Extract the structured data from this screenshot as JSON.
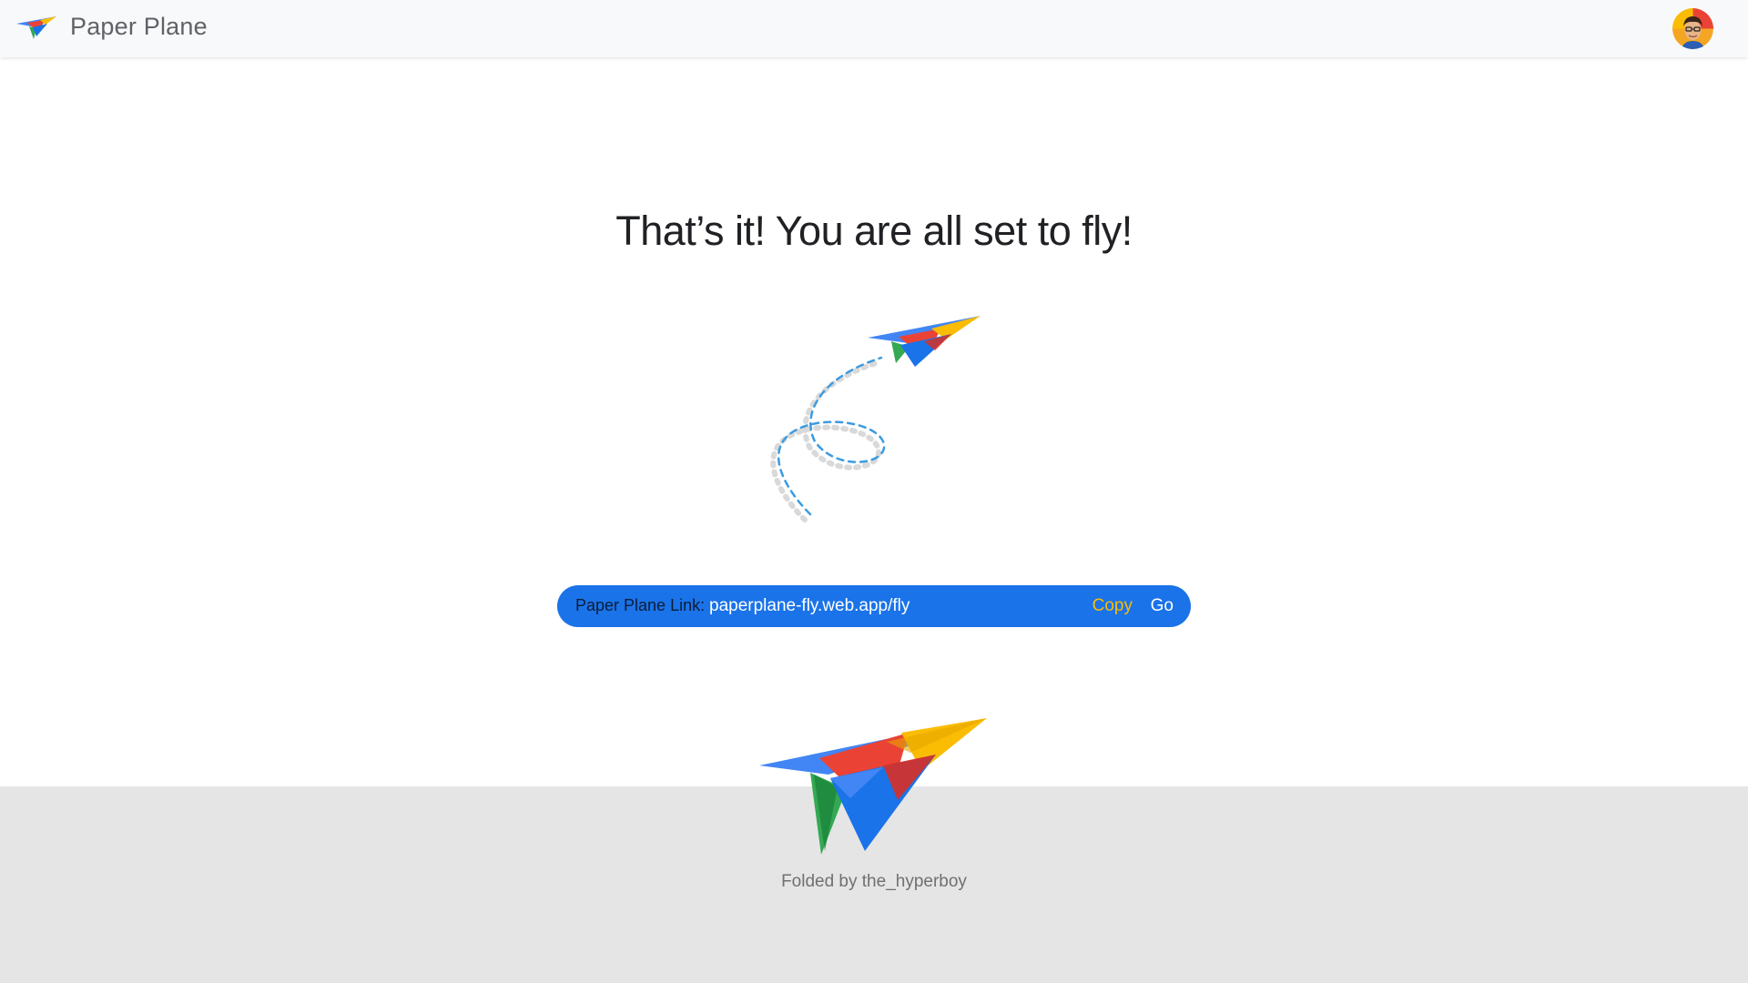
{
  "header": {
    "title": "Paper Plane",
    "logo_icon": "paper-plane-logo-icon",
    "avatar_icon": "user-avatar-icon"
  },
  "main": {
    "headline": "That’s it! You are all set to fly!",
    "illustration_icon": "paper-plane-flight-path-icon"
  },
  "link_bar": {
    "label": "Paper Plane Link:",
    "url": "paperplane-fly.web.app/fly",
    "copy_label": "Copy",
    "go_label": "Go"
  },
  "footer": {
    "credit": "Folded by the_hyperboy",
    "plane_icon": "paper-plane-large-icon"
  },
  "colors": {
    "brand_blue": "#1a73e8",
    "brand_red": "#ea4335",
    "brand_yellow": "#fbbc04",
    "brand_green": "#34a853",
    "footer_bg": "#e5e5e5",
    "header_bg": "#f8f9fa"
  }
}
